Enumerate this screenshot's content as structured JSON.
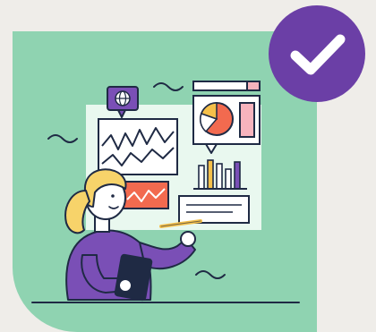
{
  "illustration": {
    "subject": "woman-presenting-analytics-dashboard",
    "elements": [
      "line-chart",
      "pie-chart",
      "bar-chart",
      "globe-icon",
      "tablet",
      "pen",
      "text-card",
      "red-line-chart"
    ]
  },
  "badge": {
    "icon": "check-icon",
    "state": "complete"
  },
  "colors": {
    "page_bg": "#efede9",
    "card_bg": "#8fd3b1",
    "board_bg": "#e9f8ef",
    "accent_purple": "#7a4fb6",
    "badge_purple": "#6b3fa6",
    "accent_orange": "#f26a4f",
    "accent_yellow": "#f5c04a",
    "accent_pink": "#f7b3bd",
    "outline": "#1f2a44",
    "hair": "#f7d36a",
    "skin": "#ffffff"
  }
}
